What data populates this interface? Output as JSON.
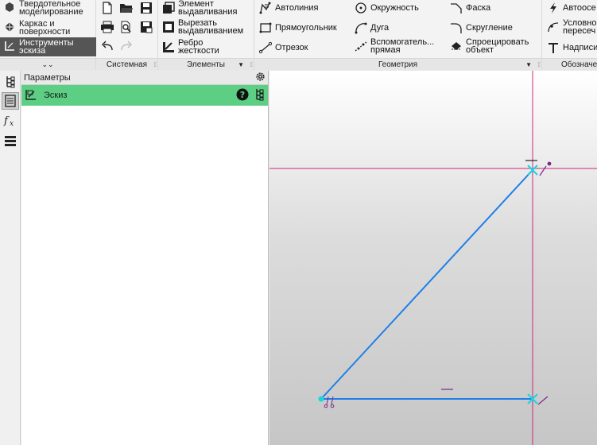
{
  "modes": {
    "solid": [
      "Твердотельное",
      "моделирование"
    ],
    "wireframe": [
      "Каркас и",
      "поверхности"
    ],
    "sketch": [
      "Инструменты",
      "эскиза"
    ]
  },
  "groups": {
    "system": "Системная",
    "elements": "Элементы",
    "geometry": "Геометрия",
    "annotation": "Обозначе"
  },
  "elements": {
    "extrude": [
      "Элемент",
      "выдавливания"
    ],
    "cut_extrude": [
      "Вырезать",
      "выдавливанием"
    ],
    "rib": [
      "Ребро",
      "жесткости"
    ]
  },
  "geometry": {
    "polyline": "Автолиния",
    "rectangle": "Прямоугольник",
    "segment": "Отрезок",
    "circle": "Окружность",
    "arc": "Дуга",
    "aux_line": [
      "Вспомогатель...",
      "прямая"
    ],
    "chamfer": "Фаска",
    "fillet": "Скругление",
    "project": [
      "Спроецировать",
      "объект"
    ]
  },
  "annotation": {
    "auto_dim": "Автоосе",
    "conditional": [
      "Условно",
      "пересеч"
    ],
    "text": "Надписи"
  },
  "panel": {
    "title": "Параметры",
    "sketch_label": "Эскиз"
  },
  "colors": {
    "accent_green": "#5ccf84",
    "sketch_line": "#1e7fe8",
    "axis_line": "#d0267a",
    "constraint": "#7a2a8a",
    "point": "#19d6e0"
  }
}
